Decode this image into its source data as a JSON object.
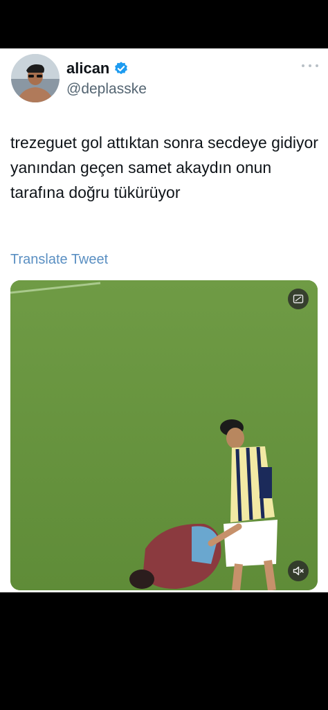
{
  "tweet": {
    "display_name": "alican",
    "handle": "@deplasske",
    "text": "trezeguet gol attıktan sonra secdeye gidiyor yanından geçen samet akaydın onun tarafına doğru tükürüyor",
    "translate_label": "Translate Tweet"
  },
  "icons": {
    "verified": "verified-badge-icon",
    "more": "more-options-icon",
    "cast": "picture-in-picture-icon",
    "mute": "volume-muted-icon"
  },
  "colors": {
    "verified_blue": "#1d9bf0",
    "translate_link": "#5a8fc2",
    "pitch_green": "#69963f"
  }
}
